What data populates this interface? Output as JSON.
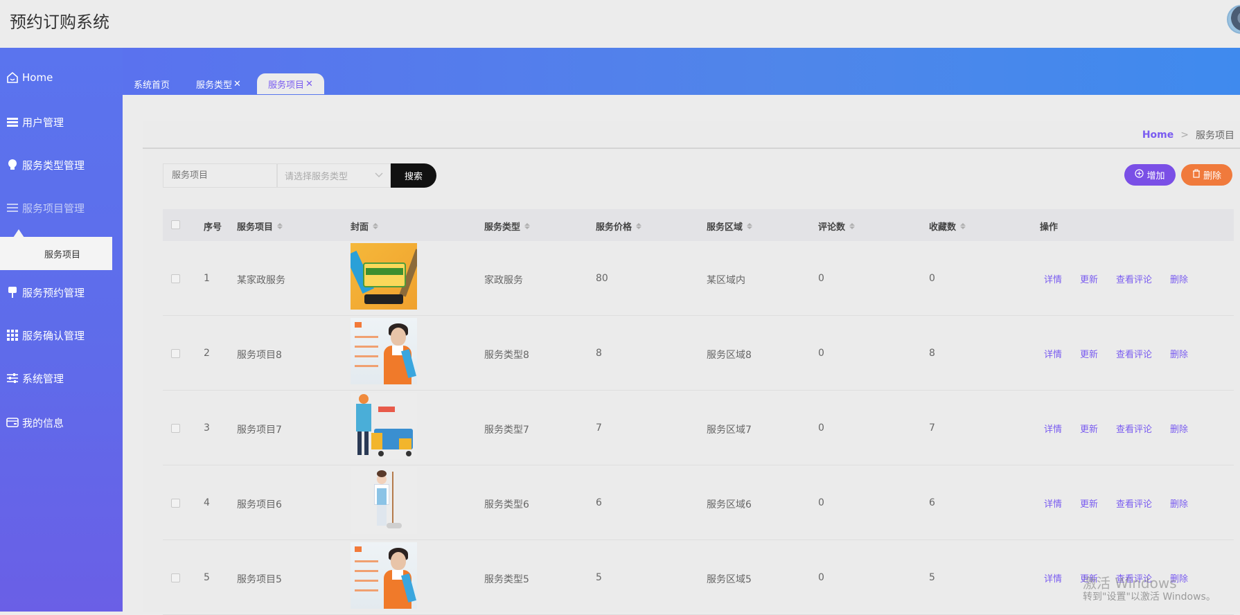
{
  "app": {
    "title": "预约订购系统"
  },
  "sidebar": {
    "items": [
      {
        "label": "Home",
        "icon": "home-icon"
      },
      {
        "label": "用户管理",
        "icon": "list-icon"
      },
      {
        "label": "服务类型管理",
        "icon": "bulb-icon"
      },
      {
        "label": "服务项目管理",
        "icon": "menu-icon"
      },
      {
        "label": "服务预约管理",
        "icon": "pin-icon"
      },
      {
        "label": "服务确认管理",
        "icon": "grid-icon"
      },
      {
        "label": "系统管理",
        "icon": "sliders-icon"
      },
      {
        "label": "我的信息",
        "icon": "card-icon"
      }
    ],
    "sub_item": "服务项目"
  },
  "tabs": [
    {
      "label": "系统首页",
      "closable": false
    },
    {
      "label": "服务类型",
      "closable": true
    },
    {
      "label": "服务项目",
      "closable": true,
      "active": true
    }
  ],
  "breadcrumb": {
    "home": "Home",
    "separator": ">",
    "current": "服务项目"
  },
  "toolbar": {
    "search_placeholder": "服务项目",
    "type_placeholder": "请选择服务类型",
    "search_label": "搜索",
    "add_label": "增加",
    "delete_label": "删除"
  },
  "table": {
    "headers": [
      "序号",
      "服务项目",
      "封面",
      "服务类型",
      "服务价格",
      "服务区域",
      "评论数",
      "收藏数",
      "操作"
    ],
    "actions": [
      "详情",
      "更新",
      "查看评论",
      "删除"
    ],
    "rows": [
      {
        "no": "1",
        "name": "某家政服务",
        "cover": "cleaning-banner",
        "type": "家政服务",
        "price": "80",
        "area": "某区域内",
        "comments": "0",
        "favorites": "0"
      },
      {
        "no": "2",
        "name": "服务项目8",
        "cover": "housekeeper-woman",
        "type": "服务类型8",
        "price": "8",
        "area": "服务区域8",
        "comments": "0",
        "favorites": "8"
      },
      {
        "no": "3",
        "name": "服务项目7",
        "cover": "cleaner-with-cart",
        "type": "服务类型7",
        "price": "7",
        "area": "服务区域7",
        "comments": "0",
        "favorites": "7"
      },
      {
        "no": "4",
        "name": "服务项目6",
        "cover": "woman-with-mop",
        "type": "服务类型6",
        "price": "6",
        "area": "服务区域6",
        "comments": "0",
        "favorites": "6"
      },
      {
        "no": "5",
        "name": "服务项目5",
        "cover": "housekeeper-woman",
        "type": "服务类型5",
        "price": "5",
        "area": "服务区域5",
        "comments": "0",
        "favorites": "5"
      }
    ]
  },
  "watermark": {
    "line1": "激活 Windows",
    "line2": "转到\"设置\"以激活 Windows。"
  },
  "colors": {
    "accent": "#7a5cf0",
    "add_button": "#7a4fe6",
    "delete_button": "#f07a3c",
    "search_button": "#111111"
  }
}
